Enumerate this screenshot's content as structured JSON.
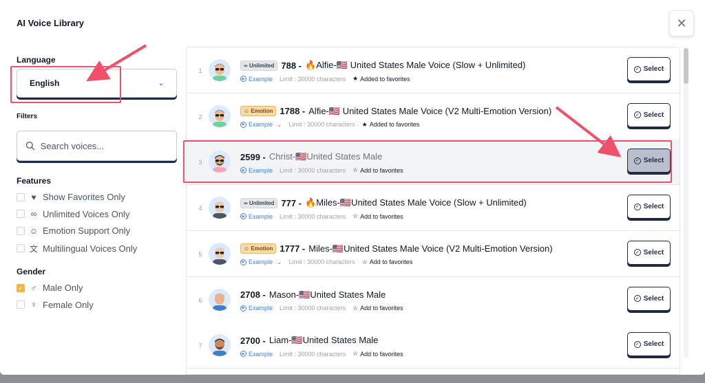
{
  "modal": {
    "title": "AI Voice Library",
    "close_glyph": "✕"
  },
  "sidebar": {
    "language_label": "Language",
    "language_value": "English",
    "filters_label": "Filters",
    "search_placeholder": "Search voices...",
    "features_label": "Features",
    "features": [
      {
        "label": "Show Favorites Only",
        "icon": "heart-icon",
        "glyph": "♥",
        "checked": false
      },
      {
        "label": "Unlimited Voices Only",
        "icon": "infinity-icon",
        "glyph": "∞",
        "checked": false
      },
      {
        "label": "Emotion Support Only",
        "icon": "smiley-icon",
        "glyph": "☺",
        "checked": false
      },
      {
        "label": "Multilingual Voices Only",
        "icon": "translate-icon",
        "glyph": "文",
        "checked": false
      }
    ],
    "gender_label": "Gender",
    "genders": [
      {
        "label": "Male Only",
        "icon": "male-icon",
        "glyph": "♂",
        "checked": true
      },
      {
        "label": "Female Only",
        "icon": "female-icon",
        "glyph": "♀",
        "checked": false
      }
    ]
  },
  "voices": [
    {
      "index": "1",
      "tag": "∞ Unlimited",
      "tag_type": "unl",
      "id": "788 -",
      "name": "🔥Alfie-🇺🇸 United States Male Voice (Slow + Unlimited)",
      "example": "Example",
      "example_chevron": false,
      "limit": "Limit : 30000 characters",
      "fav": "Added to favorites",
      "fav_glyph": "★",
      "select": "Select",
      "highlight": false,
      "avatar": {
        "skin": "#f2b98a",
        "hair": "#9ca3af",
        "shirt": "#6fd0a0",
        "glasses": true,
        "beard": false
      }
    },
    {
      "index": "2",
      "tag": "☺ Emotion",
      "tag_type": "emo",
      "id": "1788 -",
      "name": "Alfie-🇺🇸 United States Male Voice (V2 Multi-Emotion Version)",
      "example": "Example",
      "example_chevron": true,
      "limit": "Limit : 30000 characters",
      "fav": "Added to favorites",
      "fav_glyph": "★",
      "select": "Select",
      "highlight": false,
      "avatar": {
        "skin": "#f2b98a",
        "hair": "#9ca3af",
        "shirt": "#6fd0a0",
        "glasses": true,
        "beard": false
      }
    },
    {
      "index": "3",
      "tag": "",
      "tag_type": "",
      "id": "2599 -",
      "name": "Christ-🇺🇸United States Male",
      "example": "Example",
      "example_chevron": false,
      "limit": "Limit : 30000 characters",
      "fav": "Add to favorites",
      "fav_glyph": "☆",
      "select": "Select",
      "highlight": true,
      "avatar": {
        "skin": "#e8b48a",
        "hair": "#3b3b3b",
        "shirt": "#f2a7b8",
        "glasses": true,
        "beard": true
      }
    },
    {
      "index": "4",
      "tag": "∞ Unlimited",
      "tag_type": "unl",
      "id": "777 -",
      "name": "🔥Miles-🇺🇸United States Male Voice (Slow + Unlimited)",
      "example": "Example",
      "example_chevron": false,
      "limit": "Limit : 30000 characters",
      "fav": "Add to favorites",
      "fav_glyph": "☆",
      "select": "Select",
      "highlight": false,
      "avatar": {
        "skin": "#f0c8a4",
        "hair": "#d9d9d9",
        "shirt": "#4b5563",
        "glasses": true,
        "beard": true
      }
    },
    {
      "index": "5",
      "tag": "☺ Emotion",
      "tag_type": "emo",
      "id": "1777 -",
      "name": "Miles-🇺🇸United States Male Voice (V2 Multi-Emotion Version)",
      "example": "Example",
      "example_chevron": true,
      "limit": "Limit : 30000 characters",
      "fav": "Add to favorites",
      "fav_glyph": "☆",
      "select": "Select",
      "highlight": false,
      "avatar": {
        "skin": "#f0c8a4",
        "hair": "#d9d9d9",
        "shirt": "#4b5563",
        "glasses": true,
        "beard": true
      }
    },
    {
      "index": "6",
      "tag": "",
      "tag_type": "",
      "id": "2708 -",
      "name": "Mason-🇺🇸United States Male",
      "example": "Example",
      "example_chevron": false,
      "limit": "Limit : 30000 characters",
      "fav": "Add to favorites",
      "fav_glyph": "☆",
      "select": "Select",
      "highlight": false,
      "avatar": {
        "skin": "#f0b090",
        "hair": "#e8b48a",
        "shirt": "#3b82c4",
        "glasses": false,
        "beard": true
      }
    },
    {
      "index": "7",
      "tag": "",
      "tag_type": "",
      "id": "2700 -",
      "name": "Liam-🇺🇸United States Male",
      "example": "Example",
      "example_chevron": false,
      "limit": "Limit : 30000 characters",
      "fav": "Add to favorites",
      "fav_glyph": "☆",
      "select": "Select",
      "highlight": false,
      "avatar": {
        "skin": "#c98a5a",
        "hair": "#2b2b2b",
        "shirt": "#3b82c4",
        "glasses": false,
        "beard": true
      }
    }
  ],
  "colors": {
    "accent_red": "#f0506a",
    "button_navy": "#1f2a44",
    "link_blue": "#3b82f6",
    "checkbox_orange": "#f5b544"
  }
}
